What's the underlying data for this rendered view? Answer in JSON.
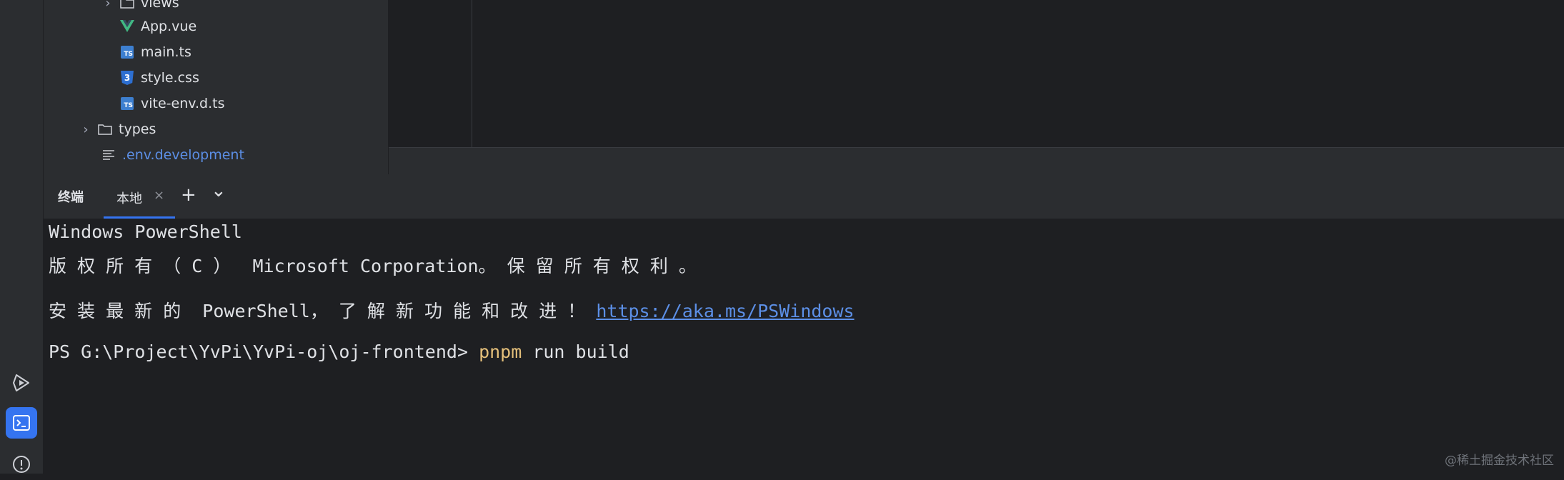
{
  "project_tree": [
    {
      "label": "views",
      "type": "folder",
      "collapsed": true
    },
    {
      "label": "App.vue",
      "type": "vue"
    },
    {
      "label": "main.ts",
      "type": "ts"
    },
    {
      "label": "style.css",
      "type": "css"
    },
    {
      "label": "vite-env.d.ts",
      "type": "ts"
    },
    {
      "label": "types",
      "type": "folder",
      "collapsed": true
    },
    {
      "label": ".env.development",
      "type": "env"
    }
  ],
  "terminal": {
    "title": "终端",
    "tab_label": "本地",
    "close_glyph": "×",
    "add_glyph": "+",
    "more_glyph": "⌄",
    "lines": {
      "l1": "Windows PowerShell",
      "l2": "版 权 所 有 （ C ）  Microsoft Corporation。 保 留 所 有 权 利 。",
      "l3_text": "安 装 最 新 的  PowerShell， 了 解 新 功 能 和 改 进 ！ ",
      "l3_link": "https://aka.ms/PSWindows",
      "prompt": "PS G:\\Project\\YvPi\\YvPi-oj\\oj-frontend> ",
      "cmd_name": "pnpm",
      "cmd_args": " run build"
    }
  },
  "watermark": "@稀土掘金技术社区",
  "colors": {
    "accent": "#3574f0",
    "link": "#5c8fe6",
    "command": "#e5c07b",
    "vue": "#41b883"
  }
}
